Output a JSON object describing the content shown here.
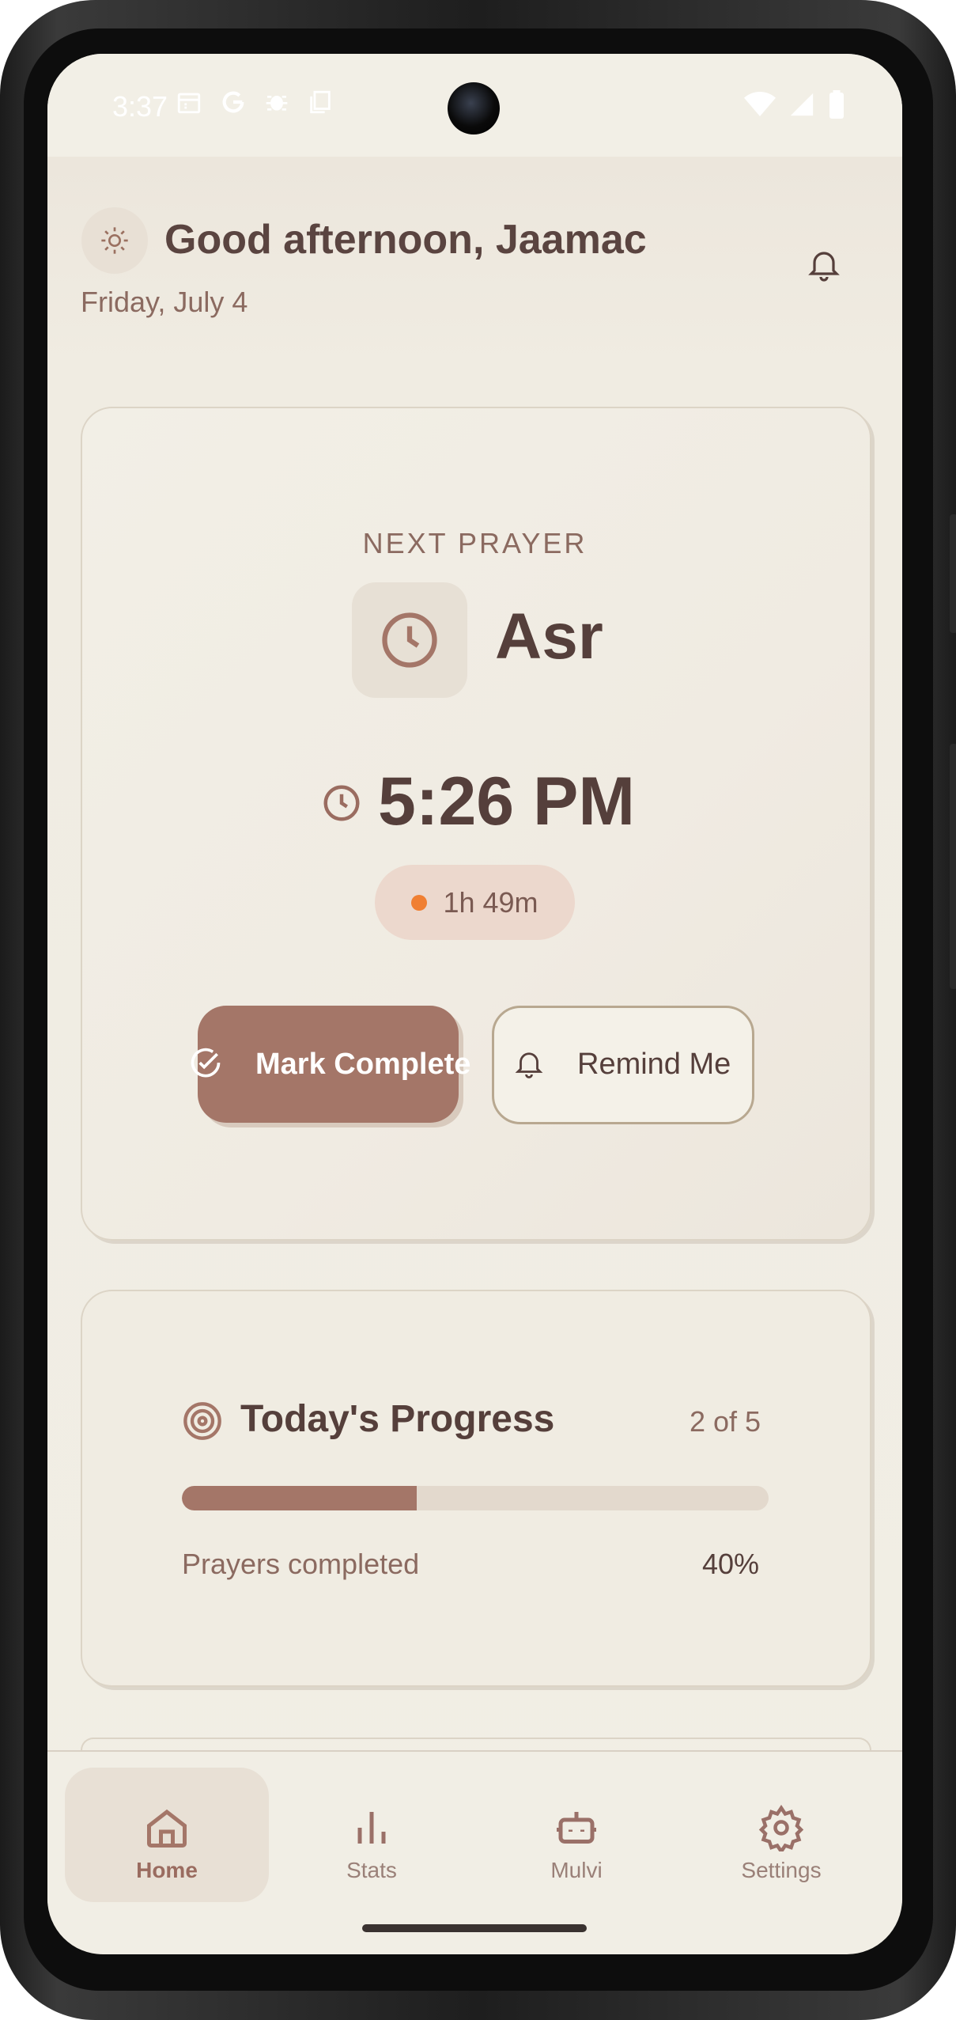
{
  "status_bar": {
    "time": "3:37",
    "left_icons": [
      "calendar-icon",
      "google-icon",
      "bug-icon",
      "copy-icon"
    ],
    "right_icons": [
      "wifi-icon",
      "signal-icon",
      "battery-icon"
    ]
  },
  "header": {
    "greeting": "Good afternoon, Jaamac",
    "date": "Friday, July 4",
    "weather_icon": "sun-icon",
    "notifications_icon": "bell-icon"
  },
  "next_prayer": {
    "label": "NEXT PRAYER",
    "name": "Asr",
    "time": "5:26 PM",
    "countdown": "1h 49m",
    "status_dot_color": "#f07f32",
    "mark_complete_label": "Mark Complete",
    "remind_me_label": "Remind Me"
  },
  "progress": {
    "title": "Today's Progress",
    "count": "2 of 5",
    "completed": 2,
    "total": 5,
    "fraction": 0.4,
    "caption": "Prayers completed",
    "percent": "40%"
  },
  "nav": {
    "items": [
      {
        "label": "Home",
        "icon": "home-icon",
        "active": true
      },
      {
        "label": "Stats",
        "icon": "bar-chart-icon",
        "active": false
      },
      {
        "label": "Mulvi",
        "icon": "robot-icon",
        "active": false
      },
      {
        "label": "Settings",
        "icon": "gear-icon",
        "active": false
      }
    ]
  },
  "colors": {
    "accent": "#a47668",
    "text_primary": "#553f3b",
    "text_secondary": "#8b6a60",
    "background": "#f1eee5"
  }
}
